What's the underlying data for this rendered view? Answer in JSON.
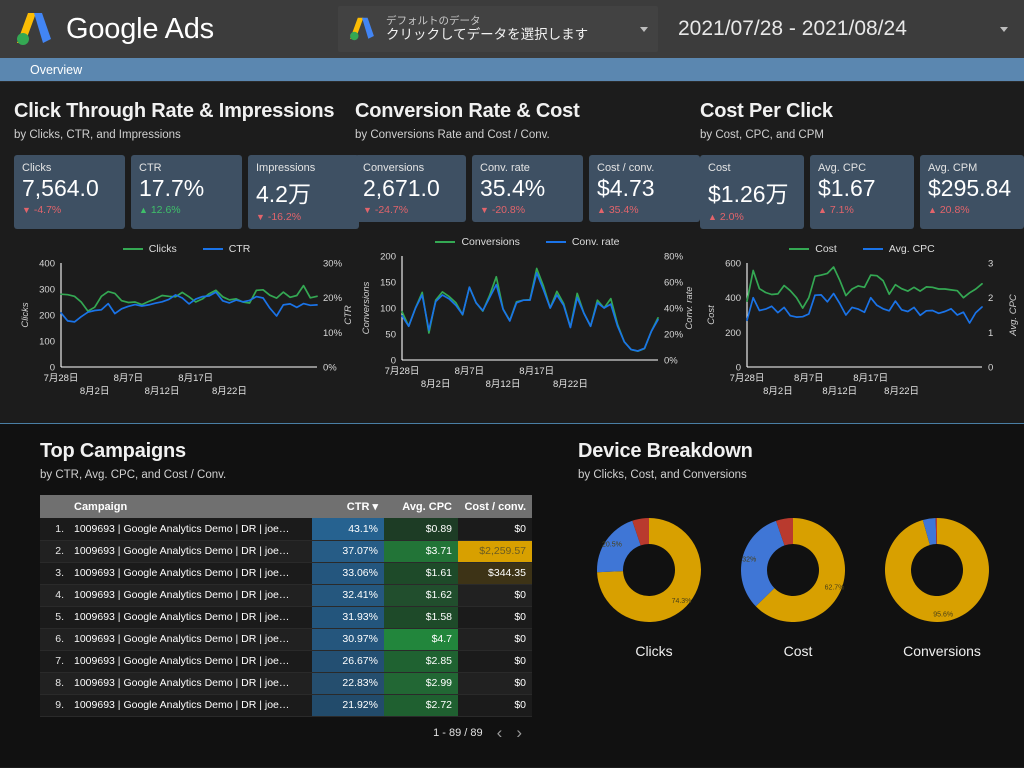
{
  "header": {
    "brand": "Google Ads",
    "data_selector": {
      "sub_label": "デフォルトのデータ",
      "main_label": "クリックしてデータを選択します",
      "caret": "chevron-down-icon"
    },
    "date_range": "2021/07/28 - 2021/08/24"
  },
  "navbar": {
    "items": [
      {
        "label": "Overview"
      }
    ]
  },
  "panels": [
    {
      "title": "Click Through Rate & Impressions",
      "subtitle": "by Clicks, CTR, and Impressions",
      "cards": [
        {
          "label": "Clicks",
          "value": "7,564.0",
          "delta": "-4.7%",
          "dir": "down",
          "tone": "red"
        },
        {
          "label": "CTR",
          "value": "17.7%",
          "delta": "12.6%",
          "dir": "up",
          "tone": "green"
        },
        {
          "label": "Impressions",
          "value": "4.2万",
          "delta": "-16.2%",
          "dir": "down",
          "tone": "red"
        }
      ]
    },
    {
      "title": "Conversion Rate & Cost",
      "subtitle": "by Conversions Rate and Cost / Conv.",
      "cards": [
        {
          "label": "Conversions",
          "value": "2,671.0",
          "delta": "-24.7%",
          "dir": "down",
          "tone": "red"
        },
        {
          "label": "Conv. rate",
          "value": "35.4%",
          "delta": "-20.8%",
          "dir": "down",
          "tone": "red"
        },
        {
          "label": "Cost / conv.",
          "value": "$4.73",
          "delta": "35.4%",
          "dir": "up",
          "tone": "red"
        }
      ]
    },
    {
      "title": "Cost Per Click",
      "subtitle": "by Cost, CPC, and CPM",
      "cards": [
        {
          "label": "Cost",
          "value": "$1.26万",
          "delta": "2.0%",
          "dir": "up",
          "tone": "red"
        },
        {
          "label": "Avg. CPC",
          "value": "$1.67",
          "delta": "7.1%",
          "dir": "up",
          "tone": "red"
        },
        {
          "label": "Avg. CPM",
          "value": "$295.84",
          "delta": "20.8%",
          "dir": "up",
          "tone": "red"
        }
      ]
    }
  ],
  "chart_data": [
    {
      "type": "line",
      "title": "Click Through Rate & Impressions",
      "xlabel": "",
      "ylabel": "Clicks",
      "y2label": "CTR",
      "ylim": [
        0,
        400
      ],
      "y2lim": [
        0,
        30
      ],
      "yticks": [
        "0",
        "100",
        "200",
        "300",
        "400"
      ],
      "y2ticks": [
        "0%",
        "10%",
        "20%",
        "30%"
      ],
      "xticks": [
        "7月28日",
        "8月2日",
        "8月7日",
        "8月12日",
        "8月17日",
        "8月22日"
      ],
      "grid": false,
      "legend": "top-center",
      "colors": {
        "Clicks": "#34a853",
        "CTR": "#1a73e8"
      },
      "series": [
        {
          "name": "Clicks",
          "axis": "left",
          "values": [
            280,
            278,
            272,
            250,
            215,
            230,
            272,
            290,
            283,
            255,
            248,
            250,
            240,
            252,
            262,
            275,
            272,
            270,
            287,
            270,
            250,
            262,
            282,
            295,
            270,
            258,
            262,
            250,
            246,
            295,
            297,
            276,
            265,
            288,
            268,
            275,
            313,
            266,
            272
          ]
        },
        {
          "name": "CTR",
          "axis": "right",
          "values": [
            15.6,
            13.3,
            13.0,
            14.5,
            15.8,
            16.3,
            16.5,
            18.3,
            15.4,
            16.8,
            17.5,
            18.0,
            17.6,
            17.9,
            18.4,
            18.8,
            19.5,
            20.8,
            19.9,
            18.2,
            19.6,
            20.3,
            20.5,
            21.6,
            19.1,
            18.5,
            19.3,
            18.8,
            19.2,
            20.3,
            19.9,
            17.0,
            14.7,
            17.9,
            18.2,
            17.2,
            18.3,
            17.8,
            17.9
          ]
        }
      ]
    },
    {
      "type": "line",
      "title": "Conversion Rate & Cost",
      "xlabel": "",
      "ylabel": "Conversions",
      "y2label": "Conv. rate",
      "ylim": [
        0,
        200
      ],
      "y2lim": [
        0,
        80
      ],
      "yticks": [
        "0",
        "50",
        "100",
        "150",
        "200"
      ],
      "y2ticks": [
        "0%",
        "20%",
        "40%",
        "60%",
        "80%"
      ],
      "xticks": [
        "7月28日",
        "8月2日",
        "8月7日",
        "8月12日",
        "8月17日",
        "8月22日"
      ],
      "grid": false,
      "legend": "top-center",
      "colors": {
        "Conversions": "#34a853",
        "Conv. rate": "#1a73e8"
      },
      "series": [
        {
          "name": "Conversions",
          "axis": "left",
          "values": [
            93,
            65,
            100,
            130,
            52,
            115,
            131,
            122,
            110,
            87,
            140,
            110,
            94,
            124,
            160,
            98,
            76,
            112,
            115,
            116,
            176,
            142,
            100,
            132,
            108,
            63,
            128,
            90,
            65,
            115,
            100,
            118,
            68,
            35,
            20,
            17,
            22,
            55,
            81
          ]
        },
        {
          "name": "Conv. rate",
          "axis": "right",
          "values": [
            34,
            26,
            40,
            50,
            23,
            45,
            50,
            47,
            42,
            35,
            56,
            44,
            38,
            48,
            58,
            39,
            30,
            44,
            46,
            46,
            67,
            54,
            40,
            50,
            42,
            25,
            48,
            36,
            26,
            44,
            40,
            43,
            26,
            14,
            8,
            7,
            9,
            22,
            31
          ]
        }
      ]
    },
    {
      "type": "line",
      "title": "Cost Per Click",
      "xlabel": "",
      "ylabel": "Cost",
      "y2label": "Avg. CPC",
      "ylim": [
        0,
        600
      ],
      "y2lim": [
        0,
        3
      ],
      "yticks": [
        "0",
        "200",
        "400",
        "600"
      ],
      "y2ticks": [
        "0",
        "1",
        "2",
        "3"
      ],
      "xticks": [
        "7月28日",
        "8月2日",
        "8月7日",
        "8月12日",
        "8月17日",
        "8月22日"
      ],
      "grid": false,
      "legend": "top-center",
      "colors": {
        "Cost": "#34a853",
        "Avg. CPC": "#1a73e8"
      },
      "series": [
        {
          "name": "Cost",
          "axis": "left",
          "values": [
            380,
            557,
            452,
            430,
            418,
            422,
            470,
            440,
            400,
            340,
            400,
            523,
            530,
            540,
            577,
            500,
            412,
            450,
            468,
            460,
            530,
            527,
            498,
            420,
            475,
            452,
            438,
            460,
            438,
            462,
            460,
            450,
            450,
            445,
            440,
            400,
            428,
            450,
            480
          ]
        },
        {
          "name": "Avg. CPC",
          "axis": "right",
          "values": [
            1.35,
            2.0,
            1.63,
            1.67,
            1.75,
            1.57,
            1.72,
            1.48,
            1.44,
            1.45,
            1.53,
            2.07,
            2.08,
            1.88,
            2.12,
            1.83,
            1.5,
            1.72,
            1.67,
            1.58,
            2.0,
            1.78,
            1.68,
            1.62,
            1.9,
            1.65,
            1.6,
            1.72,
            1.49,
            1.62,
            1.63,
            1.55,
            1.6,
            1.68,
            1.5,
            1.58,
            1.27,
            1.57,
            1.73
          ]
        }
      ]
    },
    {
      "type": "pie",
      "title": "Clicks",
      "labels": [
        "74.3%",
        "20.5%",
        ""
      ],
      "values": [
        74.3,
        20.5,
        5.2
      ],
      "colors": [
        "#d8a000",
        "#3f76d6",
        "#b93a2e"
      ]
    },
    {
      "type": "pie",
      "title": "Cost",
      "labels": [
        "62.7%",
        "32%",
        ""
      ],
      "values": [
        62.7,
        32.0,
        5.3
      ],
      "colors": [
        "#d8a000",
        "#3f76d6",
        "#b93a2e"
      ]
    },
    {
      "type": "pie",
      "title": "Conversions",
      "labels": [
        "95.6%",
        "",
        ""
      ],
      "values": [
        95.6,
        4.0,
        0.4
      ],
      "colors": [
        "#d8a000",
        "#3f76d6",
        "#b93a2e"
      ]
    }
  ],
  "campaigns_panel": {
    "title": "Top Campaigns",
    "subtitle": "by CTR, Avg. CPC, and Cost / Conv.",
    "columns": [
      "",
      "Campaign",
      "CTR",
      "Avg. CPC",
      "Cost / conv."
    ],
    "sort_indicator": "sort-descending-icon",
    "rows": [
      {
        "rank": "1.",
        "campaign": "1009693 | Google Analytics Demo | DR | joe…",
        "ctr": "43.1%",
        "cpc": "$0.89",
        "cost_conv": "$0"
      },
      {
        "rank": "2.",
        "campaign": "1009693 | Google Analytics Demo | DR | joe…",
        "ctr": "37.07%",
        "cpc": "$3.71",
        "cost_conv": "$2,259.57"
      },
      {
        "rank": "3.",
        "campaign": "1009693 | Google Analytics Demo | DR | joe…",
        "ctr": "33.06%",
        "cpc": "$1.61",
        "cost_conv": "$344.35"
      },
      {
        "rank": "4.",
        "campaign": "1009693 | Google Analytics Demo | DR | joe…",
        "ctr": "32.41%",
        "cpc": "$1.62",
        "cost_conv": "$0"
      },
      {
        "rank": "5.",
        "campaign": "1009693 | Google Analytics Demo | DR | joe…",
        "ctr": "31.93%",
        "cpc": "$1.58",
        "cost_conv": "$0"
      },
      {
        "rank": "6.",
        "campaign": "1009693 | Google Analytics Demo | DR | joe…",
        "ctr": "30.97%",
        "cpc": "$4.7",
        "cost_conv": "$0"
      },
      {
        "rank": "7.",
        "campaign": "1009693 | Google Analytics Demo | DR | joe…",
        "ctr": "26.67%",
        "cpc": "$2.85",
        "cost_conv": "$0"
      },
      {
        "rank": "8.",
        "campaign": "1009693 | Google Analytics Demo | DR | joe…",
        "ctr": "22.83%",
        "cpc": "$2.99",
        "cost_conv": "$0"
      },
      {
        "rank": "9.",
        "campaign": "1009693 | Google Analytics Demo | DR | joe…",
        "ctr": "21.92%",
        "cpc": "$2.72",
        "cost_conv": "$0"
      }
    ],
    "pagination": {
      "range": "1 - 89 / 89",
      "prev": "‹",
      "next": "›"
    }
  },
  "device_panel": {
    "title": "Device Breakdown",
    "subtitle": "by Clicks, Cost, and Conversions",
    "donuts": [
      {
        "caption": "Clicks"
      },
      {
        "caption": "Cost"
      },
      {
        "caption": "Conversions"
      }
    ]
  }
}
